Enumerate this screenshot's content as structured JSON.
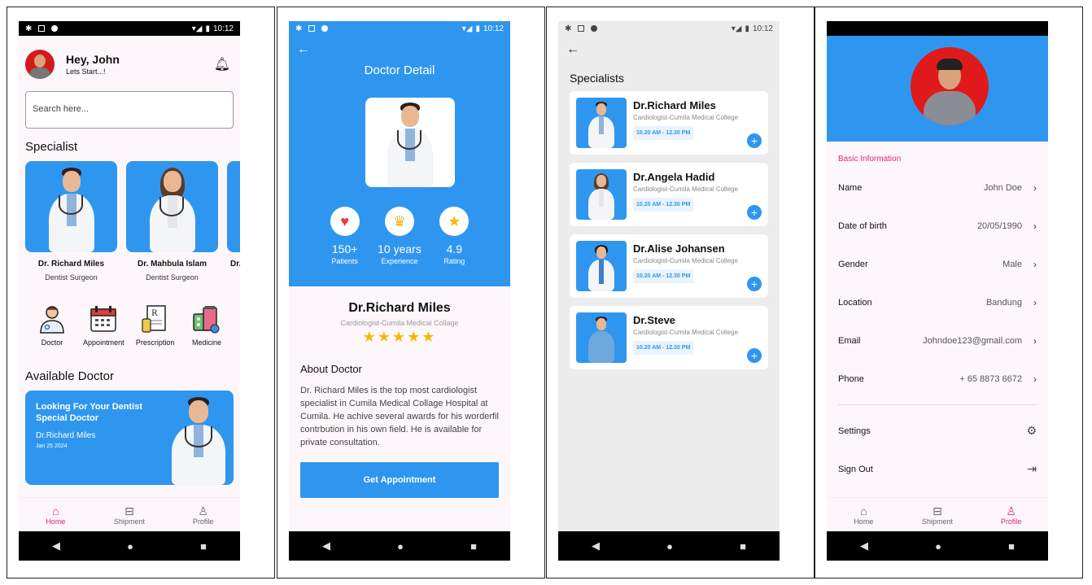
{
  "status": {
    "time": "10:12"
  },
  "screen1": {
    "greeting": "Hey, John",
    "subgreeting": "Lets Start...!",
    "search_placeholder": "Search here...",
    "specialist_title": "Specialist",
    "specialists": [
      {
        "name": "Dr. Richard Miles",
        "role": "Dentist Surgeon"
      },
      {
        "name": "Dr. Mahbula Islam",
        "role": "Dentist Surgeon"
      },
      {
        "name": "Dr.",
        "role": "I"
      }
    ],
    "categories": [
      {
        "label": "Doctor",
        "icon": "doctor-icon"
      },
      {
        "label": "Appointment",
        "icon": "calendar-icon"
      },
      {
        "label": "Prescription",
        "icon": "prescription-icon"
      },
      {
        "label": "Medicine",
        "icon": "medicine-icon"
      }
    ],
    "available_title": "Available Doctor",
    "banner": {
      "headline": "Looking For Your Dentist Special Doctor",
      "doctor": "Dr.Richard Miles",
      "date": "Jan 25 2024"
    }
  },
  "nav": {
    "home": "Home",
    "shipment": "Shipment",
    "profile": "Profile"
  },
  "screen2": {
    "title": "Doctor Detail",
    "stats": [
      {
        "value": "150+",
        "label": "Patients",
        "icon": "heart-icon"
      },
      {
        "value": "10 years",
        "label": "Experience",
        "icon": "crown-icon"
      },
      {
        "value": "4.9",
        "label": "Rating",
        "icon": "star-icon"
      }
    ],
    "name": "Dr.Richard Miles",
    "subtitle": "Cardiologist-Cumila Medical Collage",
    "stars": "★★★★★",
    "about_title": "About Doctor",
    "about_text": "Dr. Richard Miles is the top most cardiologist specialist in Cumila Medical Collage Hospital at Cumila. He achive several awards for his worderfil contrbution in his own field. He is available for private consultation.",
    "button": "Get Appointment"
  },
  "screen3": {
    "title": "Specialists",
    "doctors": [
      {
        "name": "Dr.Richard Miles",
        "subtitle": "Cardiologist-Cumila Medical College",
        "time": "10.20 AM - 12.30 PM"
      },
      {
        "name": "Dr.Angela Hadid",
        "subtitle": "Cardiologist-Cumila Medical College",
        "time": "10.20 AM - 12.30 PM"
      },
      {
        "name": "Dr.Alise Johansen",
        "subtitle": "Cardiologist-Cumila Medical College",
        "time": "10.20 AM - 12.30 PM"
      },
      {
        "name": "Dr.Steve",
        "subtitle": "Cardiologist-Cumila Medical College",
        "time": "10.20 AM - 12.30 PM"
      }
    ]
  },
  "screen4": {
    "section": "Basic Information",
    "fields": [
      {
        "label": "Name",
        "value": "John Doe"
      },
      {
        "label": "Date of birth",
        "value": "20/05/1990"
      },
      {
        "label": "Gender",
        "value": "Male"
      },
      {
        "label": "Location",
        "value": "Bandung"
      },
      {
        "label": "Email",
        "value": "Johndoe123@gmail.com"
      },
      {
        "label": "Phone",
        "value": "+ 65 8873 6672"
      }
    ],
    "settings": "Settings",
    "signout": "Sign Out"
  },
  "colors": {
    "primary": "#2f96ef",
    "accent": "#e0247a"
  }
}
